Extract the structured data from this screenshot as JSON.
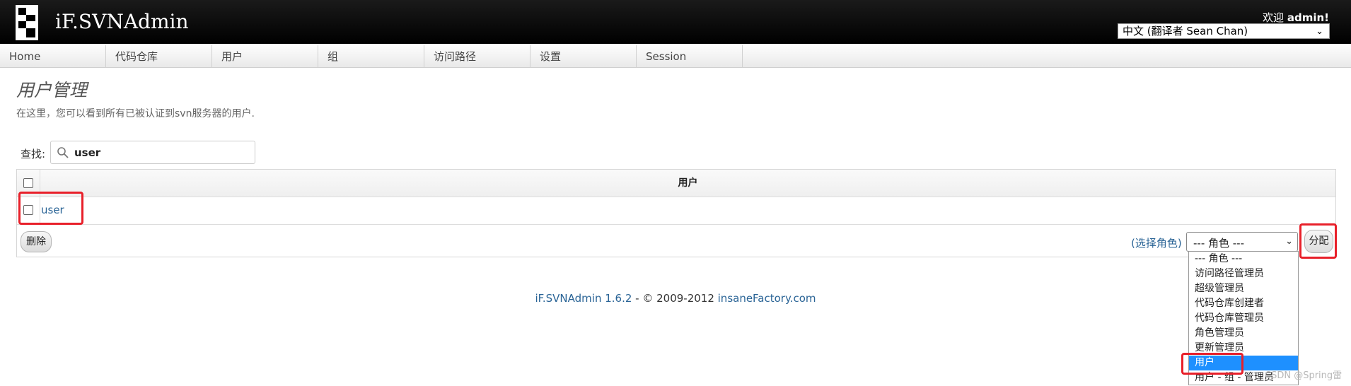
{
  "header": {
    "app_title": "iF.SVNAdmin",
    "welcome_prefix": "欢迎",
    "username": "admin!",
    "language_select": "中文 (翻译者 Sean Chan)"
  },
  "nav": {
    "items": [
      "Home",
      "代码仓库",
      "用户",
      "组",
      "访问路径",
      "设置",
      "Session"
    ]
  },
  "page": {
    "title": "用户管理",
    "description": "在这里，您可以看到所有已被认证到svn服务器的用户."
  },
  "search": {
    "label": "查找:",
    "value": "user"
  },
  "table": {
    "column_header": "用户",
    "rows": [
      "user"
    ],
    "delete_button": "删除",
    "role_hint": "(选择角色)",
    "role_select_value": "--- 角色 ---",
    "assign_button": "分配"
  },
  "role_dropdown": {
    "options": [
      "--- 角色 ---",
      "访问路径管理员",
      "超级管理员",
      "代码仓库创建者",
      "代码仓库管理员",
      "角色管理员",
      "更新管理员",
      "用户",
      "用户 - 组 - 管理员"
    ],
    "highlighted": "用户"
  },
  "footer": {
    "product": "iF.SVNAdmin 1.6.2",
    "separator": " - © 2009-2012 ",
    "company": "insaneFactory.com"
  },
  "watermark": "CSDN @Spring雷",
  "colors": {
    "header_bg": "#000000",
    "link": "#2a6496",
    "annotation": "#e8202a",
    "dropdown_highlight": "#1e90ff"
  }
}
